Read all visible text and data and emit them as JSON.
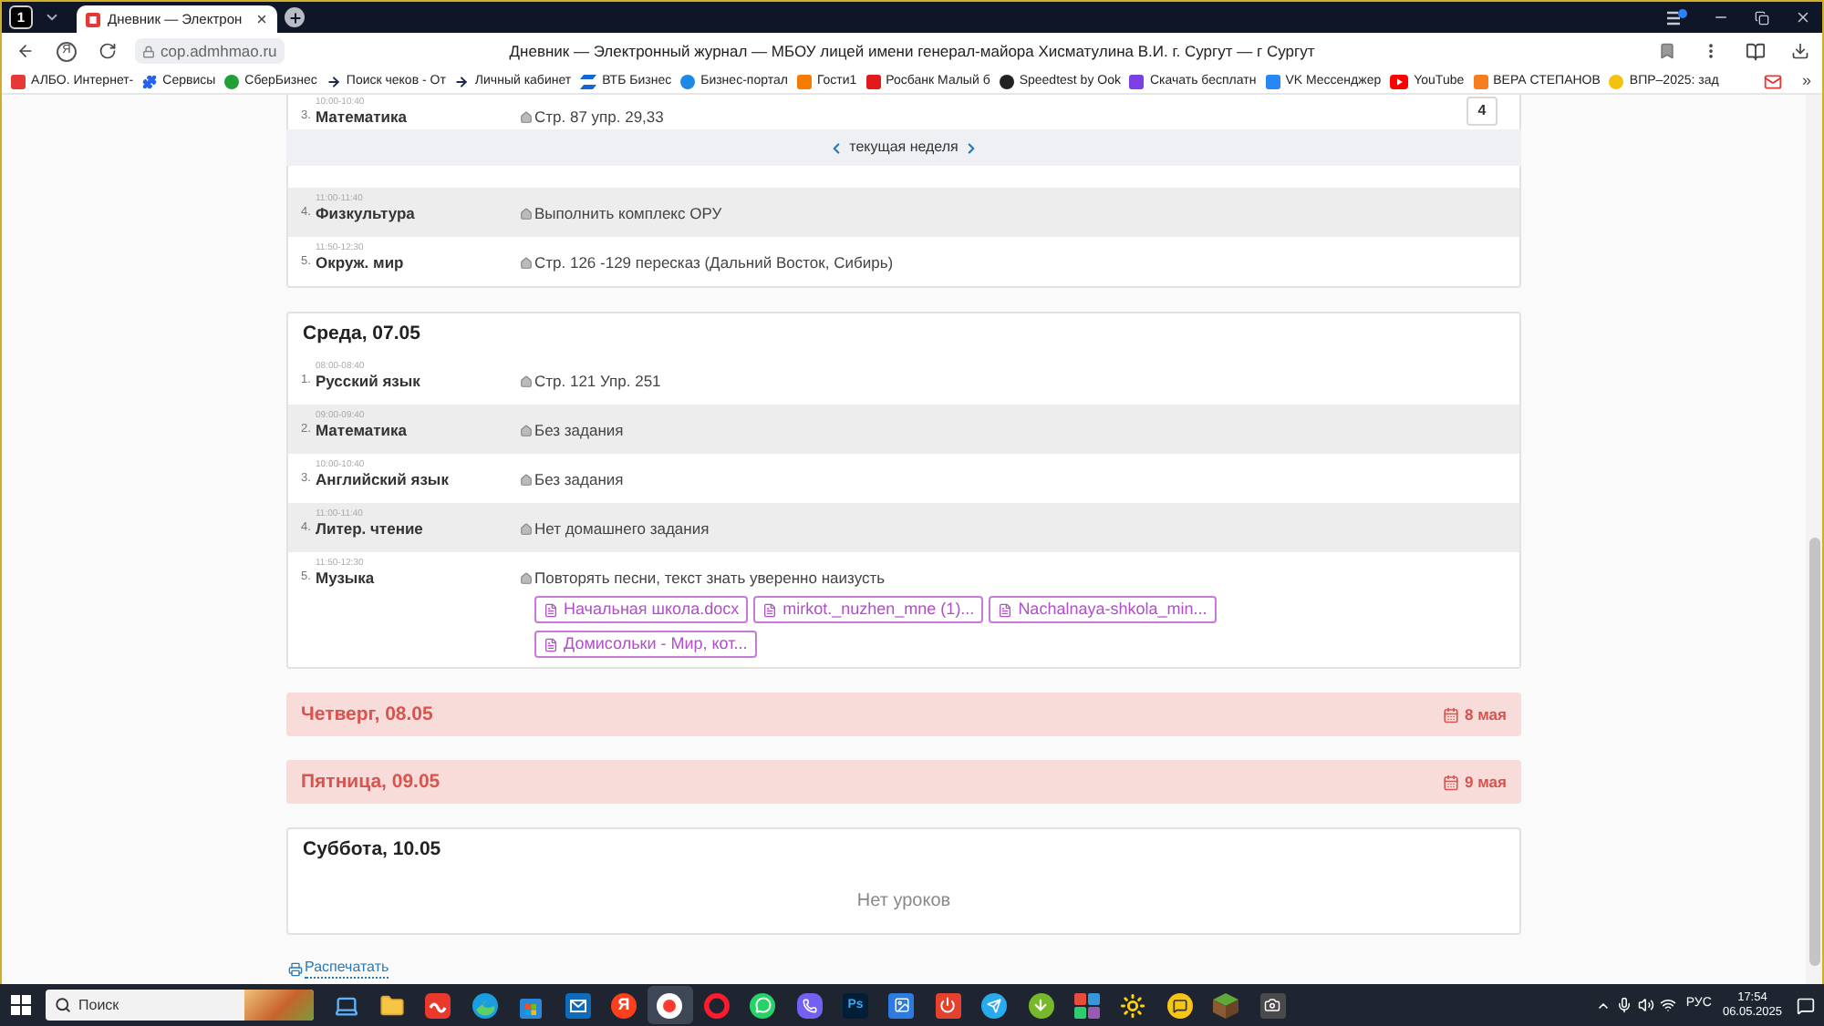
{
  "browser": {
    "tab_counter": "1",
    "tabs": [
      {
        "title": "Дневник — Электрон",
        "selected": true
      }
    ],
    "address_bar": {
      "home_glyph": "Я",
      "url": "cop.admhmao.ru",
      "page_title": "Дневник — Электронный журнал — МБОУ лицей имени генерал-майора Хисматулина В.И. г. Сургут — г Сургут"
    },
    "bookmarks": [
      {
        "label": "АЛБО. Интернет-",
        "kind": "tile",
        "color": "#e53935"
      },
      {
        "label": "Сервисы",
        "kind": "puzzle",
        "color": "#2563eb"
      },
      {
        "label": "СберБизнес",
        "kind": "circle",
        "color": "#21a038"
      },
      {
        "label": "Поиск чеков - От",
        "kind": "arrow",
        "color": "#1e2a4a"
      },
      {
        "label": "Личный кабинет",
        "kind": "arrow",
        "color": "#1e2a4a"
      },
      {
        "label": "ВТБ Бизнес",
        "kind": "stripes",
        "color": "#1565d8"
      },
      {
        "label": "Бизнес-портал",
        "kind": "circle",
        "color": "#1e88e5"
      },
      {
        "label": "Гости1",
        "kind": "tile",
        "color": "#f57c00"
      },
      {
        "label": "Росбанк Малый б",
        "kind": "tile",
        "color": "#e21a1a"
      },
      {
        "label": "Speedtest by Ook",
        "kind": "circle",
        "color": "#222222"
      },
      {
        "label": "Скачать бесплатн",
        "kind": "tile",
        "color": "#7b3fe4"
      },
      {
        "label": "VK Мессенджер",
        "kind": "tile",
        "color": "#2787f5"
      },
      {
        "label": "YouTube",
        "kind": "play",
        "color": "#ff0000"
      },
      {
        "label": "ВЕРА СТЕПАНОВ",
        "kind": "tile",
        "color": "#f57c1f"
      },
      {
        "label": "ВПР–2025: зад",
        "kind": "circle",
        "color": "#f4c20d"
      }
    ],
    "bookmarks_more": "»"
  },
  "week_nav": {
    "label": "текущая неделя"
  },
  "days": [
    {
      "kind": "lessons",
      "lessons": [
        {
          "number": "3.",
          "time": "10:00-10:40",
          "subject": "Математика",
          "homework": "Стр. 87 упр. 29,33",
          "grade": "4",
          "shaded": false
        },
        {
          "number": "4.",
          "time": "11:00-11:40",
          "subject": "Физкультура",
          "homework": "Выполнить комплекс ОРУ",
          "shaded": true
        },
        {
          "number": "5.",
          "time": "11:50-12:30",
          "subject": "Окруж. мир",
          "homework": "Стр. 126 -129 пересказ (Дальний Восток, Сибирь)",
          "shaded": false
        }
      ]
    },
    {
      "kind": "lessons",
      "title": "Среда, 07.05",
      "lessons": [
        {
          "number": "1.",
          "time": "08:00-08:40",
          "subject": "Русский язык",
          "homework": "Стр. 121 Упр. 251",
          "shaded": false
        },
        {
          "number": "2.",
          "time": "09:00-09:40",
          "subject": "Математика",
          "homework": "Без задания",
          "shaded": true
        },
        {
          "number": "3.",
          "time": "10:00-10:40",
          "subject": "Английский язык",
          "homework": "Без задания",
          "shaded": false
        },
        {
          "number": "4.",
          "time": "11:00-11:40",
          "subject": "Литер. чтение",
          "homework": "Нет домашнего задания",
          "shaded": true
        },
        {
          "number": "5.",
          "time": "11:50-12:30",
          "subject": "Музыка",
          "homework": "Повторять песни, текст знать уверенно наизусть",
          "shaded": false,
          "attachments": [
            "Начальная школа.docx",
            "mirkot._nuzhen_mne (1)...",
            "Nachalnaya-shkola_min...",
            "Домисольки - Мир, кот..."
          ]
        }
      ]
    },
    {
      "kind": "holiday",
      "title": "Четверг, 08.05",
      "date_label": "8 мая"
    },
    {
      "kind": "holiday",
      "title": "Пятница, 09.05",
      "date_label": "9 мая"
    },
    {
      "kind": "empty",
      "title": "Суббота, 10.05",
      "message": "Нет уроков"
    }
  ],
  "print_link": "Распечатать",
  "taskbar": {
    "search_placeholder": "Поиск",
    "apps": [
      {
        "kind": "laptop",
        "selected": false
      },
      {
        "kind": "folder",
        "selected": false
      },
      {
        "kind": "wave_tile",
        "selected": false
      },
      {
        "kind": "swirl",
        "selected": false
      },
      {
        "kind": "bag",
        "selected": false
      },
      {
        "kind": "mail_tile",
        "selected": false
      },
      {
        "kind": "letter_disc",
        "label": "Я",
        "selected": false
      },
      {
        "kind": "dot_disc",
        "selected": true
      },
      {
        "kind": "ring",
        "selected": false
      },
      {
        "kind": "message_disc",
        "selected": false
      },
      {
        "kind": "phone_disc",
        "selected": false
      },
      {
        "kind": "letter_tile",
        "label": "Ps",
        "selected": false
      },
      {
        "kind": "picture_tile",
        "selected": false
      },
      {
        "kind": "power_tile",
        "selected": false
      },
      {
        "kind": "plane_disc",
        "selected": false
      },
      {
        "kind": "arrow_disc",
        "selected": false
      },
      {
        "kind": "grid",
        "selected": false
      },
      {
        "kind": "sun",
        "selected": false
      },
      {
        "kind": "bubble_disc",
        "selected": false
      },
      {
        "kind": "cube",
        "selected": false
      },
      {
        "kind": "camera",
        "selected": false
      }
    ],
    "tray": {
      "language": "РУС",
      "time": "17:54",
      "date": "06.05.2025"
    }
  }
}
